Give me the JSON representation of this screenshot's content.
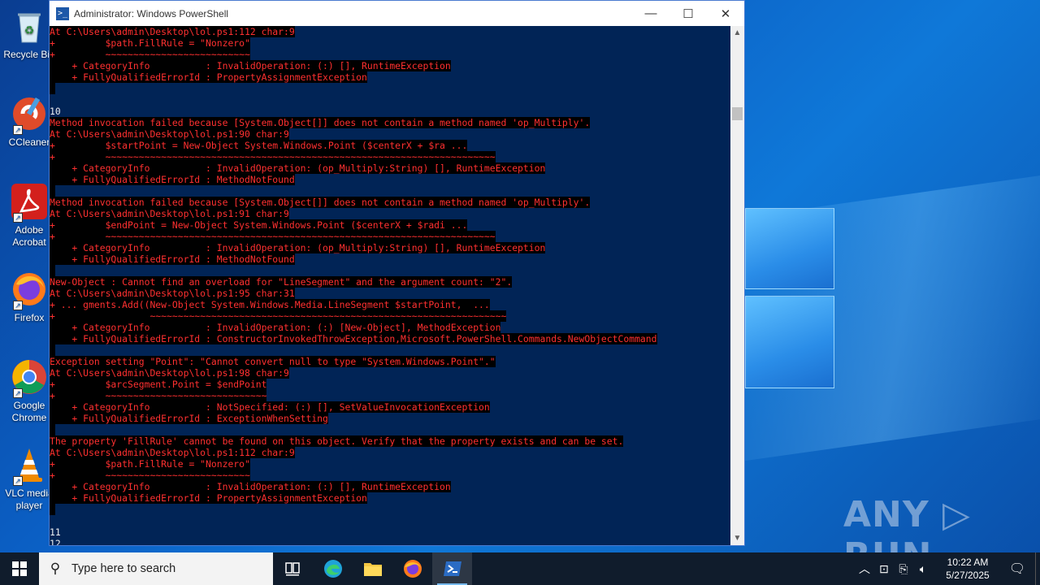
{
  "desktop": {
    "icons": [
      {
        "name": "recycle-bin",
        "label": "Recycle Bin"
      },
      {
        "name": "ccleaner",
        "label": "CCleaner"
      },
      {
        "name": "adobe-acrobat",
        "label": "Adobe Acrobat"
      },
      {
        "name": "firefox",
        "label": "Firefox"
      },
      {
        "name": "google-chrome",
        "label": "Google Chrome"
      },
      {
        "name": "vlc",
        "label": "VLC media player"
      }
    ],
    "watermark": "ANY ▷ RUN"
  },
  "window": {
    "title": "Administrator: Windows PowerShell",
    "minimize": "—",
    "maximize": "☐",
    "close": "✕"
  },
  "console": {
    "lines": [
      {
        "t": "At C:\\Users\\admin\\Desktop\\lol.ps1:112 char:9",
        "err": true
      },
      {
        "t": "+         $path.FillRule = \"Nonzero\"",
        "err": true
      },
      {
        "t": "+         ~~~~~~~~~~~~~~~~~~~~~~~~~~",
        "err": true
      },
      {
        "t": "    + CategoryInfo          : InvalidOperation: (:) [], RuntimeException",
        "err": true
      },
      {
        "t": "    + FullyQualifiedErrorId : PropertyAssignmentException",
        "err": true
      },
      {
        "t": " ",
        "err": true
      },
      {
        "t": "",
        "err": false
      },
      {
        "t": "10",
        "err": false
      },
      {
        "t": "Method invocation failed because [System.Object[]] does not contain a method named 'op_Multiply'.",
        "err": true
      },
      {
        "t": "At C:\\Users\\admin\\Desktop\\lol.ps1:90 char:9",
        "err": true
      },
      {
        "t": "+         $startPoint = New-Object System.Windows.Point ($centerX + $ra ...",
        "err": true
      },
      {
        "t": "+         ~~~~~~~~~~~~~~~~~~~~~~~~~~~~~~~~~~~~~~~~~~~~~~~~~~~~~~~~~~~~~~~~~~~~~~",
        "err": true
      },
      {
        "t": "    + CategoryInfo          : InvalidOperation: (op_Multiply:String) [], RuntimeException",
        "err": true
      },
      {
        "t": "    + FullyQualifiedErrorId : MethodNotFound",
        "err": true
      },
      {
        "t": " ",
        "err": true
      },
      {
        "t": "Method invocation failed because [System.Object[]] does not contain a method named 'op_Multiply'.",
        "err": true
      },
      {
        "t": "At C:\\Users\\admin\\Desktop\\lol.ps1:91 char:9",
        "err": true
      },
      {
        "t": "+         $endPoint = New-Object System.Windows.Point ($centerX + $radi ...",
        "err": true
      },
      {
        "t": "+         ~~~~~~~~~~~~~~~~~~~~~~~~~~~~~~~~~~~~~~~~~~~~~~~~~~~~~~~~~~~~~~~~~~~~~~",
        "err": true
      },
      {
        "t": "    + CategoryInfo          : InvalidOperation: (op_Multiply:String) [], RuntimeException",
        "err": true
      },
      {
        "t": "    + FullyQualifiedErrorId : MethodNotFound",
        "err": true
      },
      {
        "t": " ",
        "err": true
      },
      {
        "t": "New-Object : Cannot find an overload for \"LineSegment\" and the argument count: \"2\".",
        "err": true
      },
      {
        "t": "At C:\\Users\\admin\\Desktop\\lol.ps1:95 char:31",
        "err": true
      },
      {
        "t": "+ ... gments.Add((New-Object System.Windows.Media.LineSegment $startPoint,  ...",
        "err": true
      },
      {
        "t": "+                 ~~~~~~~~~~~~~~~~~~~~~~~~~~~~~~~~~~~~~~~~~~~~~~~~~~~~~~~~~~~~~~~~",
        "err": true
      },
      {
        "t": "    + CategoryInfo          : InvalidOperation: (:) [New-Object], MethodException",
        "err": true
      },
      {
        "t": "    + FullyQualifiedErrorId : ConstructorInvokedThrowException,Microsoft.PowerShell.Commands.NewObjectCommand",
        "err": true
      },
      {
        "t": " ",
        "err": true
      },
      {
        "t": "Exception setting \"Point\": \"Cannot convert null to type \"System.Windows.Point\".\"",
        "err": true
      },
      {
        "t": "At C:\\Users\\admin\\Desktop\\lol.ps1:98 char:9",
        "err": true
      },
      {
        "t": "+         $arcSegment.Point = $endPoint",
        "err": true
      },
      {
        "t": "+         ~~~~~~~~~~~~~~~~~~~~~~~~~~~~~",
        "err": true
      },
      {
        "t": "    + CategoryInfo          : NotSpecified: (:) [], SetValueInvocationException",
        "err": true
      },
      {
        "t": "    + FullyQualifiedErrorId : ExceptionWhenSetting",
        "err": true
      },
      {
        "t": " ",
        "err": true
      },
      {
        "t": "The property 'FillRule' cannot be found on this object. Verify that the property exists and can be set.",
        "err": true
      },
      {
        "t": "At C:\\Users\\admin\\Desktop\\lol.ps1:112 char:9",
        "err": true
      },
      {
        "t": "+         $path.FillRule = \"Nonzero\"",
        "err": true
      },
      {
        "t": "+         ~~~~~~~~~~~~~~~~~~~~~~~~~~",
        "err": true
      },
      {
        "t": "    + CategoryInfo          : InvalidOperation: (:) [], RuntimeException",
        "err": true
      },
      {
        "t": "    + FullyQualifiedErrorId : PropertyAssignmentException",
        "err": true
      },
      {
        "t": " ",
        "err": true
      },
      {
        "t": "",
        "err": false
      },
      {
        "t": "11",
        "err": false
      },
      {
        "t": "12",
        "err": false
      },
      {
        "t": "",
        "err": false
      }
    ]
  },
  "taskbar": {
    "search_placeholder": "Type here to search",
    "time": "10:22 AM",
    "date": "5/27/2025",
    "apps": [
      "task-view",
      "edge",
      "file-explorer",
      "firefox",
      "powershell"
    ]
  },
  "colors": {
    "console_bg": "#012456",
    "error_fg": "#ff3030",
    "error_bg": "#000000",
    "taskbar_bg": "#101c2c"
  }
}
